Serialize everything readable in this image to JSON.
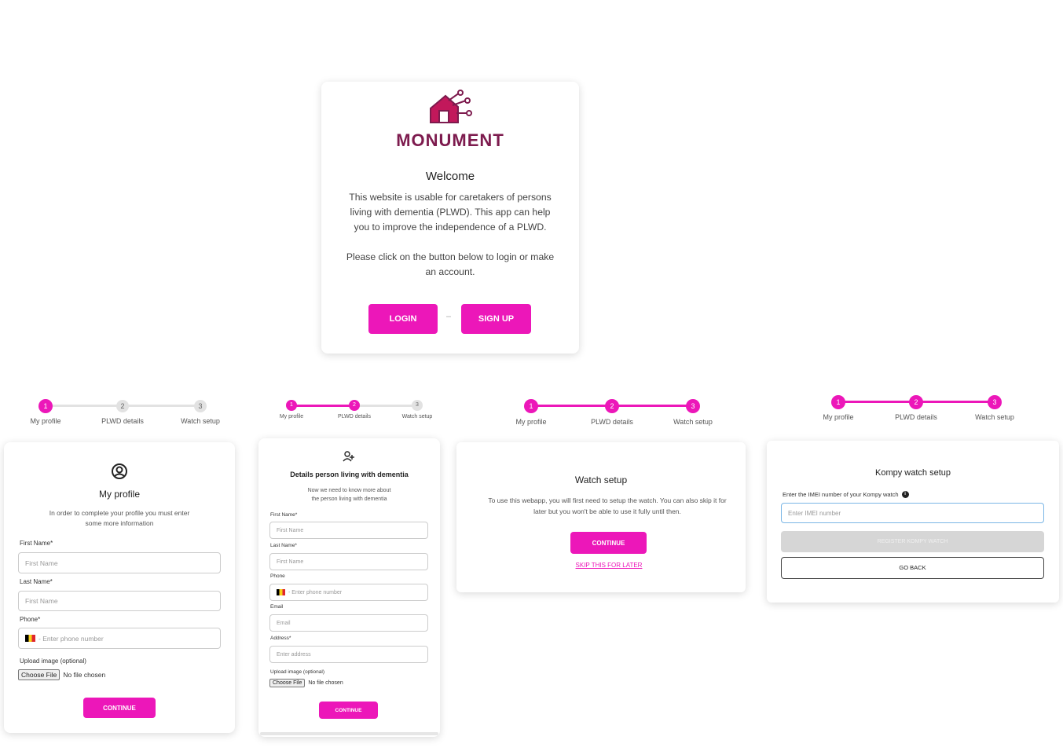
{
  "welcome": {
    "brand": "MONUMENT",
    "title": "Welcome",
    "paragraph1": [
      "This website is usable for caretakers of persons",
      "living with dementia (PLWD). This app can help",
      "you to improve the independence of a PLWD."
    ],
    "paragraph2": [
      "Please click on the button below to login or make",
      "an account."
    ],
    "login_label": "LOGIN",
    "signup_label": "SIGN UP"
  },
  "stepper": {
    "step1": "1",
    "step2": "2",
    "step3": "3",
    "label1": "My profile",
    "label2": "PLWD details",
    "label3": "Watch setup"
  },
  "profile": {
    "title": "My profile",
    "subtitle": [
      "In order to complete your profile you must enter",
      "some more information"
    ],
    "first_name_label": "First Name*",
    "first_name_placeholder": "First Name",
    "last_name_label": "Last Name*",
    "last_name_placeholder": "First Name",
    "phone_label": "Phone*",
    "phone_placeholder": "- Enter phone number",
    "upload_label": "Upload image (optional)",
    "choose_file": "Choose File",
    "no_file": "No file chosen",
    "continue": "CONTINUE"
  },
  "plwd": {
    "title": "Details person living with dementia",
    "subtitle": [
      "Now we need to know more about",
      "the person living with dementia"
    ],
    "first_name_label": "First Name*",
    "first_name_placeholder": "First Name",
    "last_name_label": "Last Name*",
    "last_name_placeholder": "First Name",
    "phone_label": "Phone",
    "phone_placeholder": "- Enter phone number",
    "email_label": "Email",
    "email_placeholder": "Email",
    "address_label": "Address*",
    "address_placeholder": "Enter address",
    "upload_label": "Upload image (optional)",
    "choose_file": "Choose File",
    "no_file": "No file chosen",
    "continue": "CONTINUE"
  },
  "watch": {
    "title": "Watch setup",
    "text": [
      "To use this webapp, you will first need to setup the watch. You can also skip it for",
      "later but you won't be able to use it fully until then."
    ],
    "continue": "CONTINUE",
    "skip": "SKIP THIS FOR LATER"
  },
  "kompy": {
    "title": "Kompy watch setup",
    "imei_label": "Enter the IMEI number of your Kompy watch",
    "imei_placeholder": "Enter IMEI number",
    "register": "REGISTER KOMPY WATCH",
    "go_back": "GO BACK"
  },
  "colors": {
    "accent": "#ec17b9",
    "brand": "#7d1b4e",
    "inactive": "#e2e2e2"
  }
}
